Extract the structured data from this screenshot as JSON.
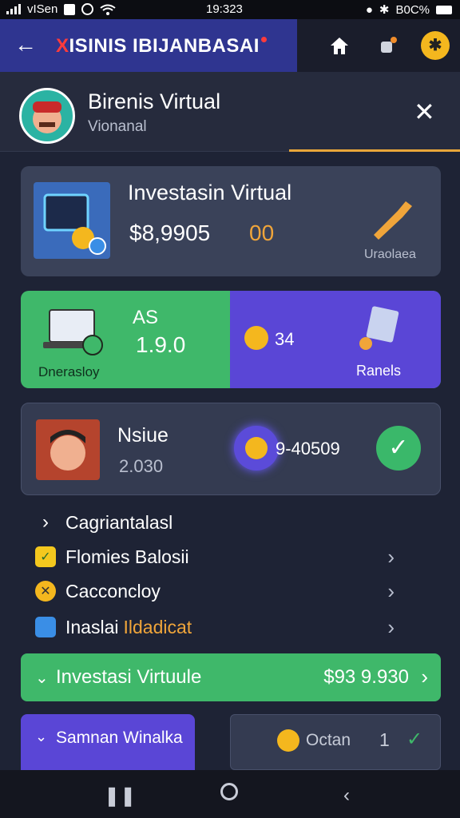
{
  "status": {
    "carrier": "vISen",
    "time": "19:323",
    "battery": "B0C%"
  },
  "topbar": {
    "title_prefix": "X",
    "title_rest": "ISINIS IBIJANBASAI"
  },
  "subheader": {
    "title": "Birenis Virtual",
    "subtitle": "Vionanal"
  },
  "card1": {
    "title": "Investasin Virtual",
    "amount": "$8,9905",
    "highlight": "00",
    "label": "Uraolaea"
  },
  "card2": {
    "left_top": "AS",
    "left_value": "1.9.0",
    "left_label": "Dnerasloy",
    "right_value": "34",
    "right_label": "Ranels"
  },
  "card3": {
    "name": "Nsiue",
    "score": "2.030",
    "value": "9-40509"
  },
  "menu": [
    {
      "label": "Cagriantalasl",
      "icon": "chevron-right-icon"
    },
    {
      "label": "Flomies Balosii",
      "icon": "check-box-icon"
    },
    {
      "label": "Cacconcloy",
      "icon": "gold-coin-icon"
    },
    {
      "label_prefix": "Inaslai",
      "label_suffix": "Ildadicat",
      "icon": "card-icon"
    }
  ],
  "greenbar": {
    "label": "Investasi Virtuule",
    "amount": "$93 9.930"
  },
  "bottom": {
    "left_label": "Samnan Winalka",
    "right_label": "Octan",
    "right_count": "1"
  },
  "colors": {
    "topbar_blue": "#2f3590",
    "green": "#3fb86a",
    "purple": "#5a46d6",
    "gold": "#f4b71e",
    "accent_orange": "#e8a63a"
  }
}
